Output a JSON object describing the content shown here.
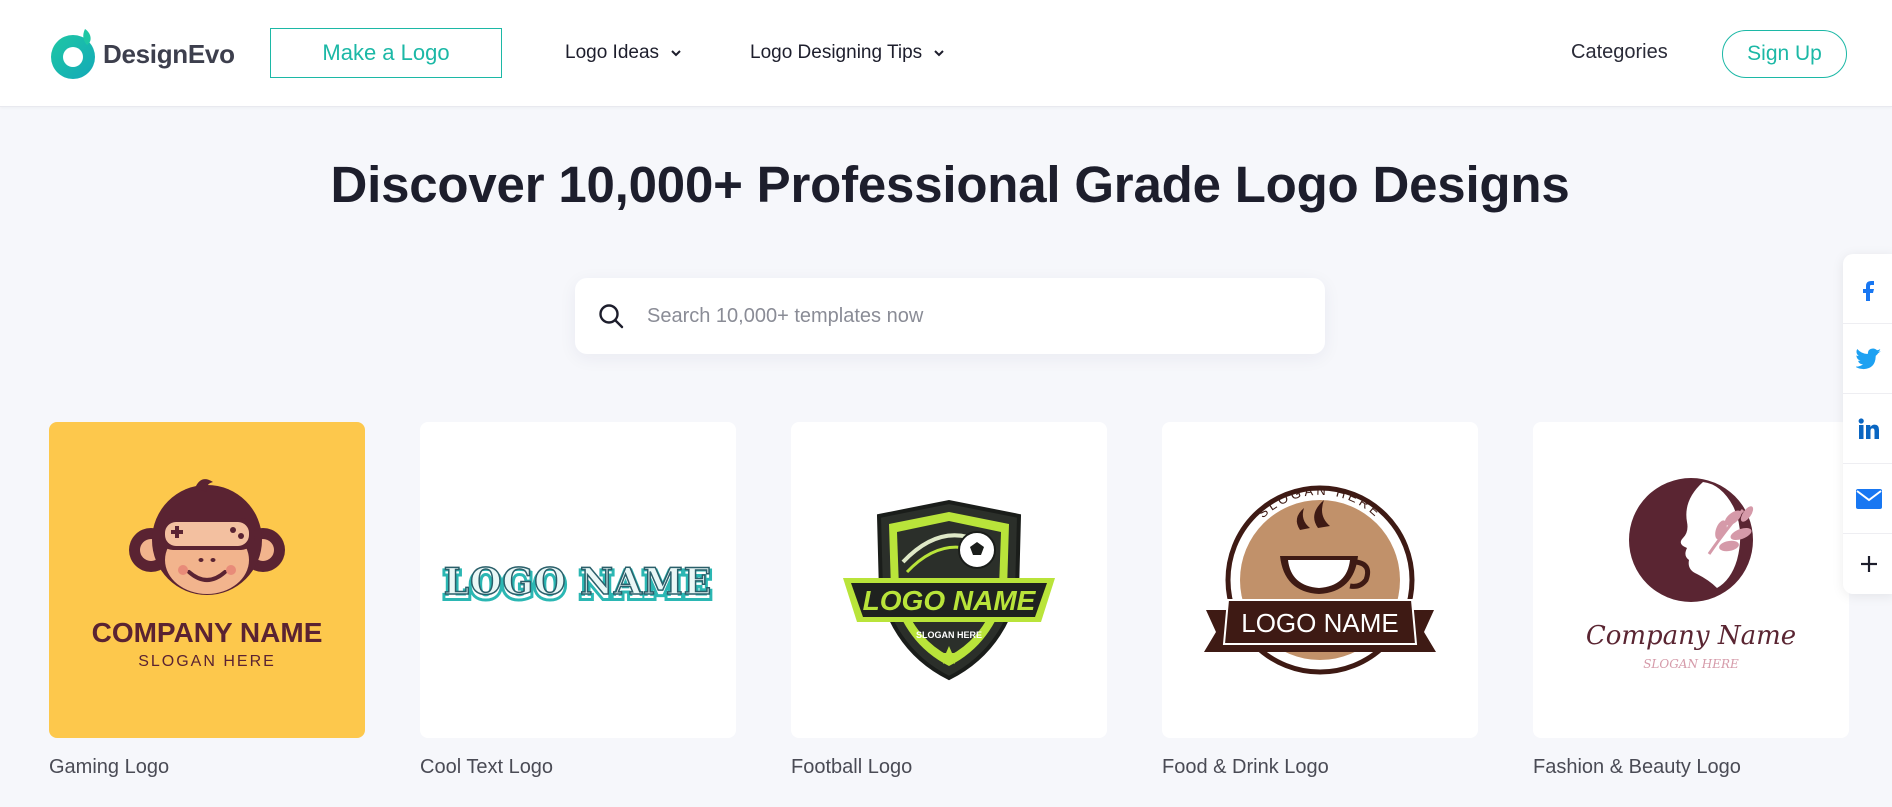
{
  "header": {
    "brand": "DesignEvo",
    "make_logo_label": "Make a Logo",
    "nav": [
      {
        "label": "Logo Ideas",
        "icon": "chevron-down-icon"
      },
      {
        "label": "Logo Designing Tips",
        "icon": "chevron-down-icon"
      }
    ],
    "categories_label": "Categories",
    "signup_label": "Sign Up"
  },
  "hero": {
    "title": "Discover 10,000+ Professional Grade Logo Designs",
    "search_placeholder": "Search 10,000+ templates now",
    "search_icon": "search-icon"
  },
  "cards": [
    {
      "caption": "Gaming Logo",
      "logo_text": "COMPANY NAME",
      "logo_slogan": "SLOGAN HERE",
      "bg": "#fdc84c"
    },
    {
      "caption": "Cool Text Logo",
      "logo_text": "LOGO NAME",
      "bg": "#ffffff"
    },
    {
      "caption": "Football Logo",
      "logo_text": "LOGO NAME",
      "logo_slogan": "SLOGAN HERE",
      "bg": "#ffffff"
    },
    {
      "caption": "Food & Drink Logo",
      "logo_text": "LOGO NAME",
      "logo_slogan": "SLOGAN HERE",
      "bg": "#ffffff"
    },
    {
      "caption": "Fashion & Beauty Logo",
      "logo_text": "Company Name",
      "logo_slogan": "SLOGAN HERE",
      "bg": "#ffffff"
    }
  ],
  "share": [
    "facebook-icon",
    "twitter-icon",
    "linkedin-icon",
    "email-icon",
    "plus-icon"
  ],
  "colors": {
    "accent": "#1cb8a6",
    "background": "#f6f7fb",
    "text": "#1d1e2c"
  }
}
